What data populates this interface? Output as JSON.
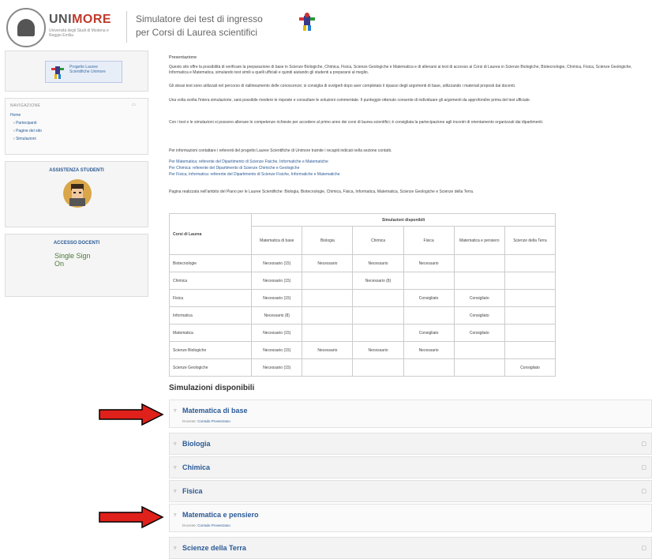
{
  "header": {
    "logo_uni": "UNI",
    "logo_more": "MORE",
    "logo_subtitle": "Università degli Studi di Modena e Reggio Emilia",
    "title_line1": "Simulatore dei test di ingresso",
    "title_line2": "per Corsi di Laurea scientifici"
  },
  "sidebar": {
    "logo_text": "Progetto Lauree Scientifiche Unimore",
    "nav_title": "NAVIGAZIONE",
    "nav_items": [
      "Home",
      "Partecipanti",
      "Pagine del sito",
      "Simulazioni"
    ],
    "assist_title": "ASSISTENZA STUDENTI",
    "access_title": "ACCESSO DOCENTI",
    "spid_text": "Single Sign On"
  },
  "intro": {
    "heading": "Presentazione",
    "para1": "Questo sito offre la possibilità di verificare la preparazione di base in Scienze Biologiche, Chimica, Fisica, Scienze Geologiche e Matematica e di allenarsi ai test di accesso ai Corsi di Laurea in Scienze Biologiche, Biotecnologie, Chimica, Fisica, Scienze Geologiche, Informatica e Matematica, simulando test simili a quelli ufficiali e quindi aiutando gli studenti a prepararsi al meglio.",
    "para2": "Gli stessi test sono utilizzati nel percorso di riallineamento delle conoscenze; si consiglia di svolgerli dopo aver completato il ripasso degli argomenti di base, utilizzando i materiali proposti dai docenti.",
    "para3": "Una volta svolta l'intera simulazione, sarà possibile rivedere le risposte e consultare le soluzioni commentate. Il punteggio ottenuto consente di individuare gli argomenti da approfondire prima del test ufficiale.",
    "para4": "Con i test e le simulazioni si possono allenare le competenze richieste per accedere al primo anno dei corsi di laurea scientifici; è consigliata la partecipazione agli incontri di orientamento organizzati dai dipartimenti.",
    "para5": "Per informazioni contattare i referenti del progetto Lauree Scientifiche di Unimore tramite i recapiti indicati nella sezione contatti.",
    "para6": "Per Matematica: referente del Dipartimento di Scienze Fisiche, Informatiche e Matematiche",
    "para7": "Per Chimica: referente del Dipartimento di Scienze Chimiche e Geologiche",
    "para8": "Per Fisica, Informatica: referente del Dipartimento di Scienze Fisiche, Informatiche e Matematiche",
    "para9": "Pagina realizzata nell'ambito del Piano per le Lauree Scientifiche: Biologia, Biotecnologie, Chimica, Fisica, Informatica, Matematica, Scienze Geologiche e Scienze della Terra."
  },
  "table": {
    "corner_header": "Corsi di Laurea",
    "group_header": "Simulazioni disponibili",
    "columns": [
      "Matematica di base",
      "Biologia",
      "Chimica",
      "Fisica",
      "Matematica e pensiero",
      "Scienze della Terra"
    ],
    "rows": [
      {
        "course": "Biotecnologie",
        "cells": [
          "Necessario (15)",
          "Necessario",
          "Necessario",
          "Necessario",
          "",
          ""
        ]
      },
      {
        "course": "Chimica",
        "cells": [
          "Necessario (15)",
          "",
          "Necessario (8)",
          "",
          "",
          ""
        ]
      },
      {
        "course": "Fisica",
        "cells": [
          "Necessario (15)",
          "",
          "",
          "Consigliato",
          "Consigliato",
          ""
        ]
      },
      {
        "course": "Informatica",
        "cells": [
          "Necessario (8)",
          "",
          "",
          "",
          "Consigliato",
          ""
        ]
      },
      {
        "course": "Matematica",
        "cells": [
          "Necessario (15)",
          "",
          "",
          "Consigliato",
          "Consigliato",
          ""
        ]
      },
      {
        "course": "Scienze Biologiche",
        "cells": [
          "Necessario (15)",
          "Necessario",
          "Necessario",
          "Necessario",
          "",
          ""
        ]
      },
      {
        "course": "Scienze Geologiche",
        "cells": [
          "Necessario (15)",
          "",
          "",
          "",
          "",
          "Consigliato"
        ]
      }
    ]
  },
  "simulations": {
    "heading": "Simulazioni disponibili",
    "items": [
      {
        "label": "Matematica di base",
        "sub_prefix": "Docente:",
        "sub_link": "Corrado Provenzano",
        "expanded": true
      },
      {
        "label": "Biologia",
        "expanded": false
      },
      {
        "label": "Chimica",
        "expanded": false
      },
      {
        "label": "Fisica",
        "expanded": false
      },
      {
        "label": "Matematica e pensiero",
        "sub_prefix": "Docente:",
        "sub_link": "Corrado Provenzano",
        "expanded": true
      },
      {
        "label": "Scienze della Terra",
        "expanded": false
      }
    ]
  },
  "colors": {
    "accent_blue": "#2a5a96",
    "arrow_red": "#e0201b",
    "brand_red": "#c0392b"
  }
}
